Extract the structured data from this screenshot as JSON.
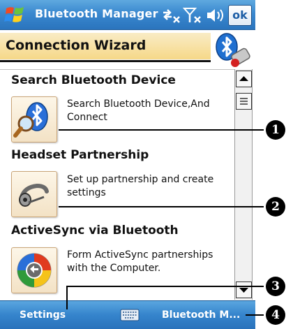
{
  "titlebar": {
    "title": "Bluetooth Manager",
    "ok_label": "ok"
  },
  "wizard": {
    "title": "Connection Wizard"
  },
  "items": [
    {
      "title": "Search Bluetooth Device",
      "description": "Search Bluetooth Device,And Connect",
      "icon": "bluetooth-search-icon"
    },
    {
      "title": "Headset Partnership",
      "description": "Set up partnership and create settings",
      "icon": "headset-icon"
    },
    {
      "title": "ActiveSync via Bluetooth",
      "description": "Form ActiveSync partnerships with the Computer.",
      "icon": "activesync-icon"
    }
  ],
  "menubar": {
    "left_label": "Settings",
    "right_label": "Bluetooth M..."
  },
  "callouts": [
    "1",
    "2",
    "3",
    "4"
  ],
  "colors": {
    "titlebar_blue": "#3a88cf",
    "wizard_strip": "#f6d888",
    "menubar_blue": "#3584cc"
  }
}
